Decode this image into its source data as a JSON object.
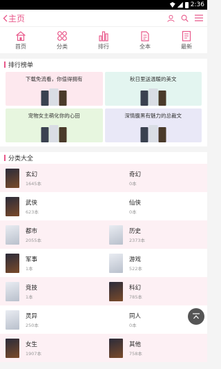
{
  "status": {
    "time": "2:36"
  },
  "header": {
    "back_label": "主页"
  },
  "nav": [
    {
      "label": "首页",
      "icon": "home-icon"
    },
    {
      "label": "分类",
      "icon": "category-icon"
    },
    {
      "label": "排行",
      "icon": "rank-icon"
    },
    {
      "label": "全本",
      "icon": "books-icon"
    },
    {
      "label": "最新",
      "icon": "latest-icon"
    }
  ],
  "ranking": {
    "title": "排行榜单",
    "cards": [
      {
        "title": "下载免流看，你值得拥有",
        "bg": "#fde8ee"
      },
      {
        "title": "秋日里送温暖的美文",
        "bg": "#e3f5f0"
      },
      {
        "title": "宠物女主萌化你的心田",
        "bg": "#e7f6df"
      },
      {
        "title": "深情腹黑有魅力的总裁文",
        "bg": "#e9e8f7"
      }
    ]
  },
  "categories": {
    "title": "分类大全",
    "rows": [
      [
        {
          "name": "玄幻",
          "count": "1645本",
          "cover": "dark"
        },
        {
          "name": "奇幻",
          "count": "0本",
          "cover": ""
        }
      ],
      [
        {
          "name": "武侠",
          "count": "623本",
          "cover": "dark"
        },
        {
          "name": "仙侠",
          "count": "0本",
          "cover": ""
        }
      ],
      [
        {
          "name": "都市",
          "count": "2055本",
          "cover": "light"
        },
        {
          "name": "历史",
          "count": "2373本",
          "cover": "light"
        }
      ],
      [
        {
          "name": "军事",
          "count": "1本",
          "cover": "dark"
        },
        {
          "name": "游戏",
          "count": "522本",
          "cover": "light"
        }
      ],
      [
        {
          "name": "竞技",
          "count": "1本",
          "cover": "light"
        },
        {
          "name": "科幻",
          "count": "785本",
          "cover": "dark"
        }
      ],
      [
        {
          "name": "灵异",
          "count": "250本",
          "cover": "light"
        },
        {
          "name": "同人",
          "count": "0本",
          "cover": ""
        }
      ],
      [
        {
          "name": "女生",
          "count": "1907本",
          "cover": "dark"
        },
        {
          "name": "其他",
          "count": "758本",
          "cover": "dark"
        }
      ]
    ]
  },
  "colors": {
    "accent": "#e8588a"
  }
}
